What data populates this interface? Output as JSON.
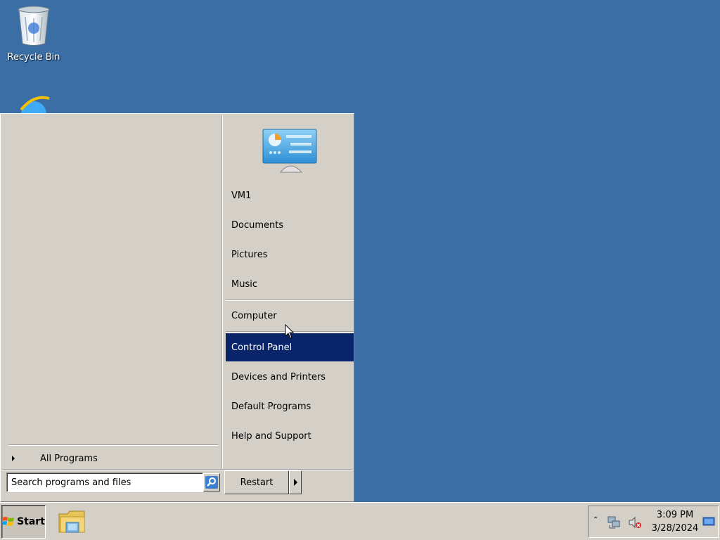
{
  "desktop": {
    "icons": [
      {
        "label": "Recycle Bin",
        "icon": "recycle-bin-icon"
      },
      {
        "label": "",
        "icon": "internet-explorer-icon"
      }
    ]
  },
  "start_menu": {
    "all_programs_label": "All Programs",
    "user_icon": "control-panel-picture-icon",
    "right_items": [
      {
        "label": "VM1"
      },
      {
        "label": "Documents"
      },
      {
        "label": "Pictures"
      },
      {
        "label": "Music"
      },
      {
        "label": "Computer"
      },
      {
        "label": "Control Panel",
        "selected": true
      },
      {
        "label": "Devices and Printers"
      },
      {
        "label": "Default Programs"
      },
      {
        "label": "Help and Support"
      }
    ],
    "search": {
      "placeholder": "Search programs and files",
      "value": ""
    },
    "restart_label": "Restart"
  },
  "taskbar": {
    "start_label": "Start",
    "pinned": [
      {
        "icon": "windows-explorer-icon"
      }
    ],
    "tray": {
      "time": "3:09 PM",
      "date": "3/28/2024"
    }
  },
  "colors": {
    "desktop": "#3a6ea5",
    "menu_bg": "#d4d0c8",
    "selection": "#0a246a"
  }
}
